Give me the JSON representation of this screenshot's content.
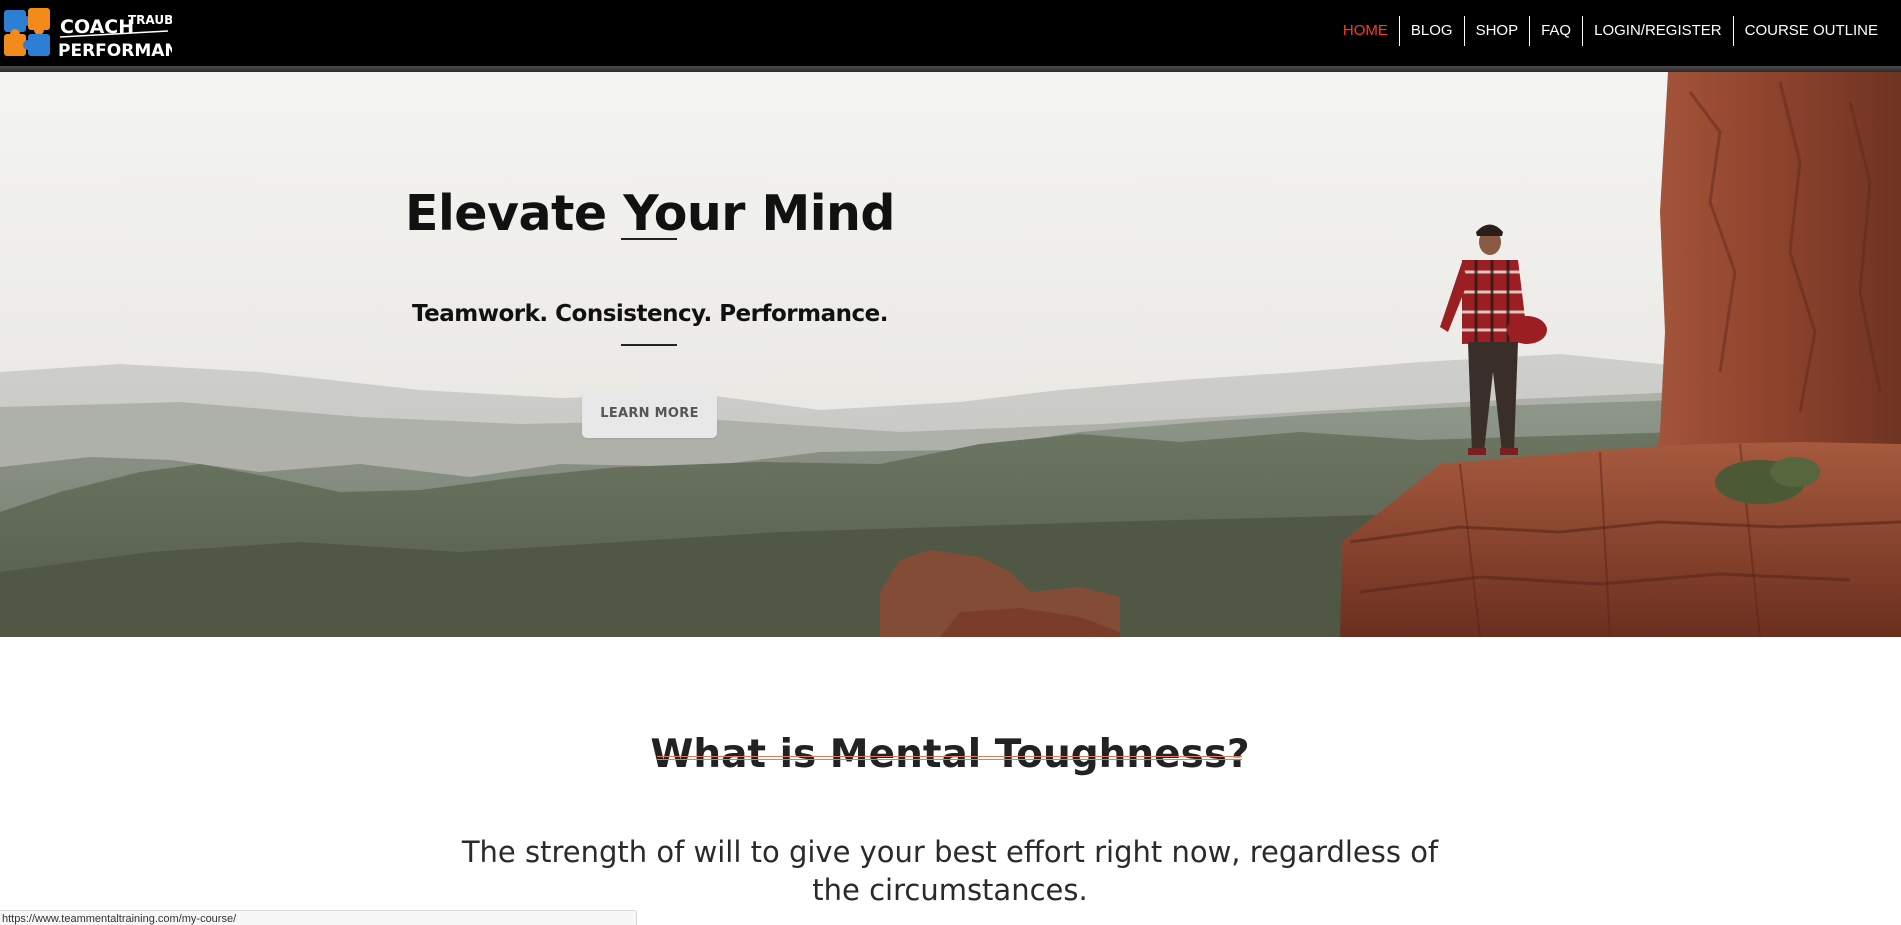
{
  "header": {
    "logo": {
      "line1": "COACH",
      "line1b": "TRAUB",
      "line2": "PERFORMANCE"
    },
    "nav": [
      {
        "label": "HOME",
        "active": true
      },
      {
        "label": "BLOG",
        "active": false
      },
      {
        "label": "SHOP",
        "active": false
      },
      {
        "label": "FAQ",
        "active": false
      },
      {
        "label": "LOGIN/REGISTER",
        "active": false
      },
      {
        "label": "COURSE OUTLINE",
        "active": false
      }
    ]
  },
  "hero": {
    "title": "Elevate Your Mind",
    "subtitle": "Teamwork. Consistency. Performance.",
    "button_label": "LEARN MORE"
  },
  "section": {
    "title": "What is Mental Toughness?",
    "text": "The strength of will to give your best effort right now, regardless of the circumstances."
  },
  "status_bar": {
    "url": "https://www.teammentaltraining.com/my-course/"
  },
  "colors": {
    "nav_active": "#ff3b1f",
    "accent_underline": "#e07a5a",
    "topbar_bg": "#000000"
  }
}
